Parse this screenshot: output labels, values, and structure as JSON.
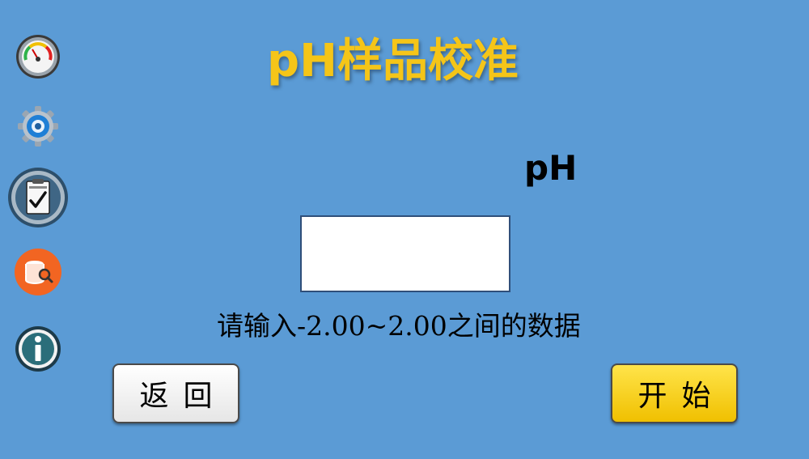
{
  "header": {
    "title": "pH样品校准"
  },
  "sidebar": {
    "items": [
      {
        "icon": "gauge-icon"
      },
      {
        "icon": "gear-icon"
      },
      {
        "icon": "calibration-clipboard-icon"
      },
      {
        "icon": "database-search-icon"
      },
      {
        "icon": "info-icon"
      }
    ]
  },
  "form": {
    "unit_label": "pH",
    "value": "",
    "hint": "请输入-2.00~2.00之间的数据"
  },
  "buttons": {
    "back_label": "返回",
    "start_label": "开始"
  },
  "colors": {
    "background": "#5b9bd5",
    "title": "#f5c518",
    "start_button": "#ffd700"
  }
}
